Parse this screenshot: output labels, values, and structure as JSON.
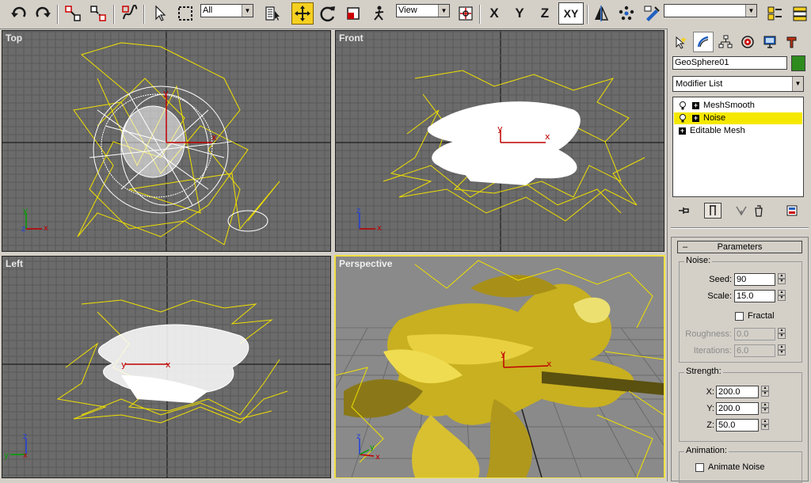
{
  "toolbar": {
    "selection_filter": "All",
    "ref_coord": "View",
    "axis_x": "X",
    "axis_y": "Y",
    "axis_z": "Z",
    "axis_xy": "XY",
    "named_selection": ""
  },
  "viewports": {
    "top": "Top",
    "front": "Front",
    "left": "Left",
    "perspective": "Perspective"
  },
  "axes": {
    "x": "x",
    "y": "y",
    "z": "z"
  },
  "gizmo": {
    "x": "x",
    "y": "y"
  },
  "panel": {
    "object_name": "GeoSphere01",
    "object_color": "#2e8b1e",
    "modifier_list": "Modifier List",
    "stack": [
      {
        "label": "MeshSmooth",
        "selected": false
      },
      {
        "label": "Noise",
        "selected": true
      },
      {
        "label": "Editable Mesh",
        "selected": false
      }
    ],
    "parameters": {
      "title": "Parameters",
      "noise_group": "Noise:",
      "seed_label": "Seed:",
      "seed": "90",
      "scale_label": "Scale:",
      "scale": "15.0",
      "fractal_label": "Fractal",
      "roughness_label": "Roughness:",
      "roughness": "0.0",
      "iterations_label": "Iterations:",
      "iterations": "6.0",
      "strength_group": "Strength:",
      "x_label": "X:",
      "x": "200.0",
      "y_label": "Y:",
      "y": "200.0",
      "z_label": "Z:",
      "z": "50.0",
      "animation_group": "Animation:",
      "animate_noise_label": "Animate Noise"
    }
  },
  "colors": {
    "viewport_bg": "#6b6b6b",
    "grid": "#5a5a5a",
    "grid_axis": "#1e1e1e",
    "wire_yellow": "#f0e000",
    "mesh_white": "#ffffff",
    "active_border": "#f0e040",
    "selected_modifier": "#f5e800"
  }
}
